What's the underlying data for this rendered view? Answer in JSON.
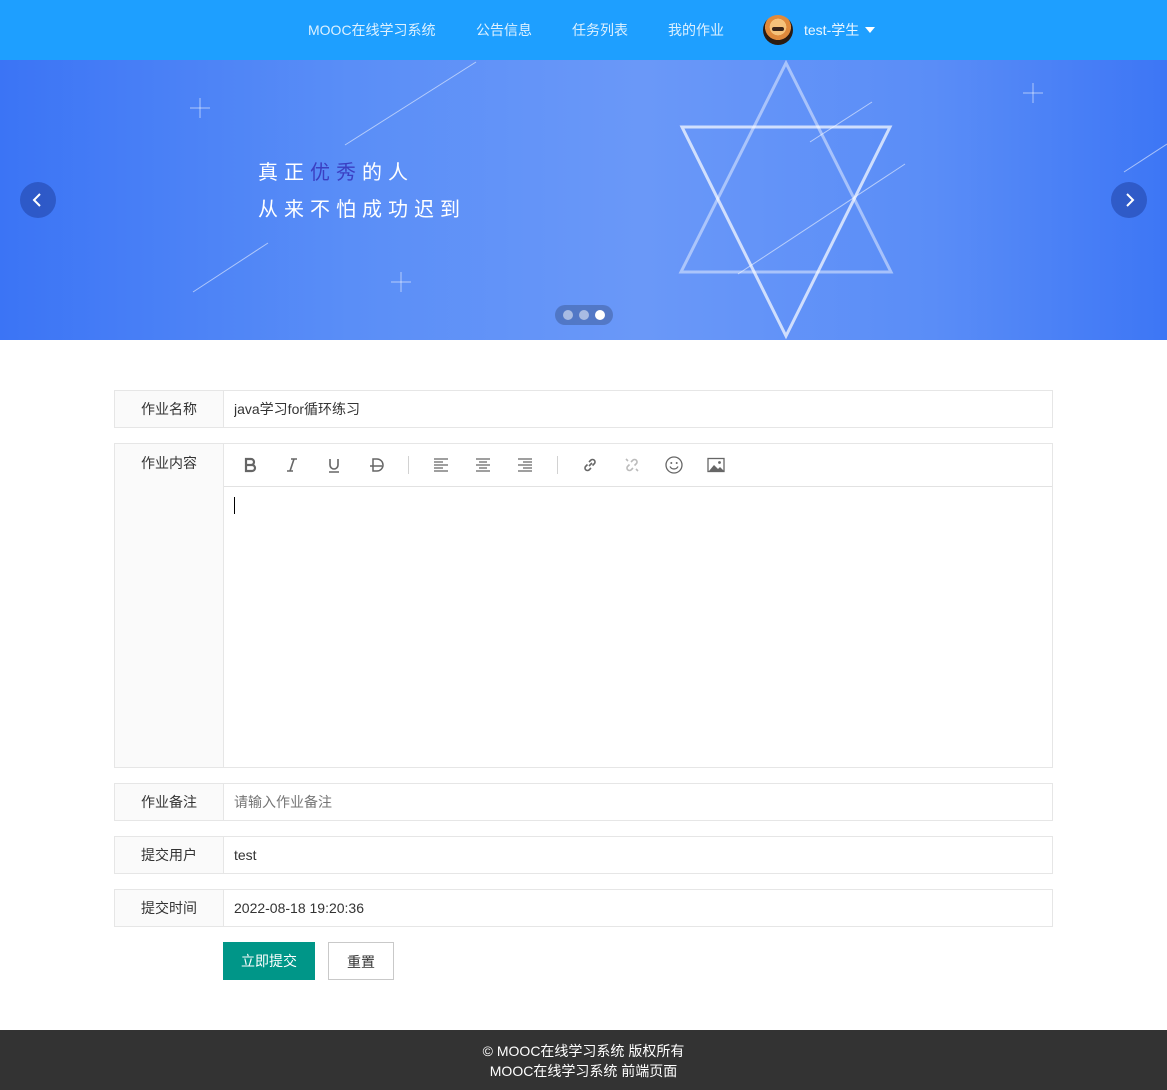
{
  "nav": {
    "brand": "MOOC在线学习系统",
    "items": [
      "公告信息",
      "任务列表",
      "我的作业"
    ],
    "user": "test-学生"
  },
  "banner": {
    "line1_pre": "真正",
    "line1_highlight": "优秀",
    "line1_post": "的人",
    "line2": "从来不怕成功迟到",
    "slides": 3,
    "active_slide": 3
  },
  "form": {
    "name_label": "作业名称",
    "name_value": "java学习for循环练习",
    "content_label": "作业内容",
    "content_value": "",
    "remark_label": "作业备注",
    "remark_placeholder": "请输入作业备注",
    "user_label": "提交用户",
    "user_value": "test",
    "time_label": "提交时间",
    "time_value": "2022-08-18 19:20:36",
    "submit_label": "立即提交",
    "reset_label": "重置"
  },
  "editor_toolbar": [
    "bold-icon",
    "italic-icon",
    "underline-icon",
    "strikethrough-icon",
    "align-left-icon",
    "align-center-icon",
    "align-right-icon",
    "link-icon",
    "unlink-icon",
    "emoji-icon",
    "image-icon"
  ],
  "footer": {
    "line1": "© MOOC在线学习系统 版权所有",
    "line2": "MOOC在线学习系统 前端页面"
  },
  "colors": {
    "header": "#1E9FFF",
    "primary_button": "#009688",
    "footer": "#333333"
  }
}
